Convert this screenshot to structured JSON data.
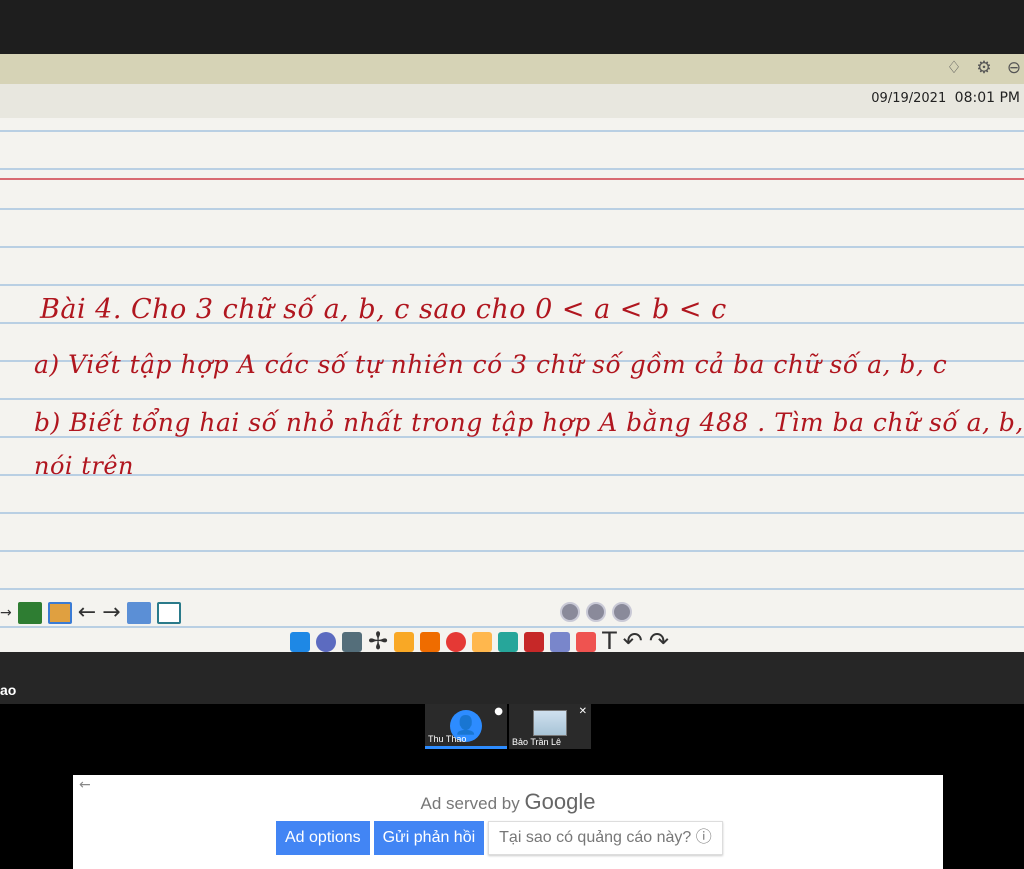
{
  "board": {
    "date": "09/19/2021",
    "time": "08:01 PM",
    "lines": [
      "Bài 4.  Cho 3 chữ số a, b, c sao cho  0 < a < b < c",
      "a) Viết tập hợp A các số tự nhiên có 3 chữ số gồm  cả ba chữ số a, b, c",
      "b) Biết tổng hai số nhỏ nhất trong tập hợp A bằng 488 . Tìm ba chữ số a, b, c",
      "nói trên"
    ]
  },
  "icons": {
    "bell": "bell-icon",
    "settings": "gear-icon",
    "minus": "minus-circle-icon"
  },
  "left_label": "ao",
  "participants": [
    {
      "name": "Thu Thao",
      "avatar": "person-icon"
    },
    {
      "name": "Bảo Trần Lê",
      "avatar": "video-thumbnail"
    }
  ],
  "ad": {
    "served_by": "Ad served by",
    "brand": "Google",
    "options_label": "Ad options",
    "feedback_label": "Gửi phản hồi",
    "why_label": "Tại sao có quảng cáo này? ⓘ"
  },
  "colors": {
    "ink": "#b0161f",
    "accent": "#2d8cff",
    "ad_button": "#4285f4"
  }
}
